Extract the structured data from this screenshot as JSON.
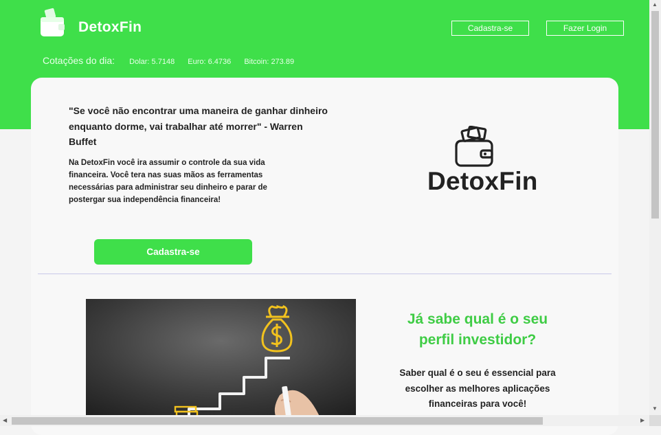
{
  "header": {
    "brand": "DetoxFin",
    "signup_label": "Cadastra-se",
    "login_label": "Fazer Login",
    "rates_label": "Cotações do dia:",
    "rates": [
      "Dolar: 5.7148",
      "Euro: 6.4736",
      "Bitcoin: 273.89"
    ]
  },
  "intro": {
    "quote": "\"Se você não encontrar uma maneira de ganhar dinheiro enquanto dorme, vai trabalhar até morrer\" - Warren Buffet",
    "description": "Na DetoxFin você ira assumir o controle da sua vida financeira. Você tera nas suas mãos as ferramentas necessárias para administrar seu dinheiro e parar de postergar sua independência financeira!",
    "cta_label": "Cadastra-se",
    "logo_text": "DetoxFin"
  },
  "profile": {
    "title": "Já sabe qual é o seu perfil investidor?",
    "text": "Saber qual é o seu é essencial para escolher as melhores aplicações financeiras para você!"
  },
  "colors": {
    "accent": "#3fdf4a",
    "heading_green": "#3fcc45",
    "text": "#222222"
  },
  "icons": [
    "wallet-icon",
    "money-bag-icon",
    "scroll-up-arrow",
    "scroll-down-arrow",
    "scroll-left-arrow",
    "scroll-right-arrow"
  ]
}
